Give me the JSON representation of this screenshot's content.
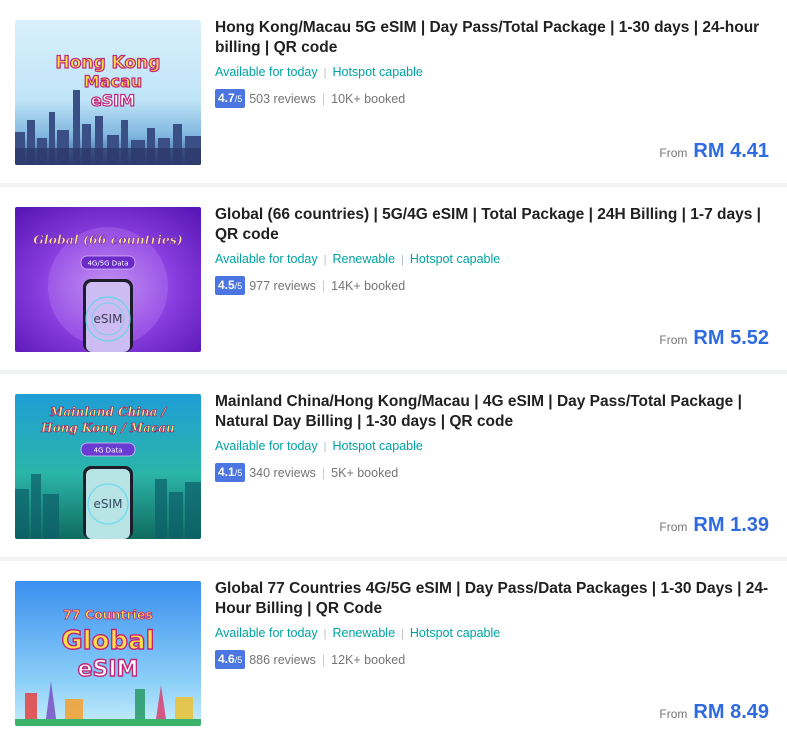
{
  "products": [
    {
      "title": "Hong Kong/Macau 5G eSIM | Day Pass/Total Package | 1-30 days | 24-hour billing | QR code",
      "tags": [
        "Available for today",
        "Hotspot capable"
      ],
      "rating": "4.7",
      "rating_scale": "/5",
      "reviews": "503 reviews",
      "booked": "10K+ booked",
      "price_prefix": "From",
      "price": "RM 4.41",
      "image_text": [
        "Hong Kong",
        "Macau",
        "eSIM"
      ]
    },
    {
      "title": "Global (66 countries) | 5G/4G eSIM | Total Package | 24H Billing | 1-7 days | QR code",
      "tags": [
        "Available for today",
        "Renewable",
        "Hotspot capable"
      ],
      "rating": "4.5",
      "rating_scale": "/5",
      "reviews": "977 reviews",
      "booked": "14K+ booked",
      "price_prefix": "From",
      "price": "RM 5.52",
      "image_text": [
        "Global (66 countries)",
        "4G/5G Data",
        "eSIM"
      ]
    },
    {
      "title": "Mainland China/Hong Kong/Macau | 4G eSIM | Day Pass/Total Package | Natural Day Billing | 1-30 days | QR code",
      "tags": [
        "Available for today",
        "Hotspot capable"
      ],
      "rating": "4.1",
      "rating_scale": "/5",
      "reviews": "340 reviews",
      "booked": "5K+ booked",
      "price_prefix": "From",
      "price": "RM 1.39",
      "image_text": [
        "Mainland China /",
        "Hong Kong / Macau",
        "4G Data",
        "eSIM"
      ]
    },
    {
      "title": "Global 77 Countries 4G/5G eSIM | Day Pass/Data Packages | 1-30 Days | 24-Hour Billing | QR Code",
      "tags": [
        "Available for today",
        "Renewable",
        "Hotspot capable"
      ],
      "rating": "4.6",
      "rating_scale": "/5",
      "reviews": "886 reviews",
      "booked": "12K+ booked",
      "price_prefix": "From",
      "price": "RM 8.49",
      "image_text": [
        "77 Countries",
        "Global",
        "eSIM"
      ]
    }
  ]
}
